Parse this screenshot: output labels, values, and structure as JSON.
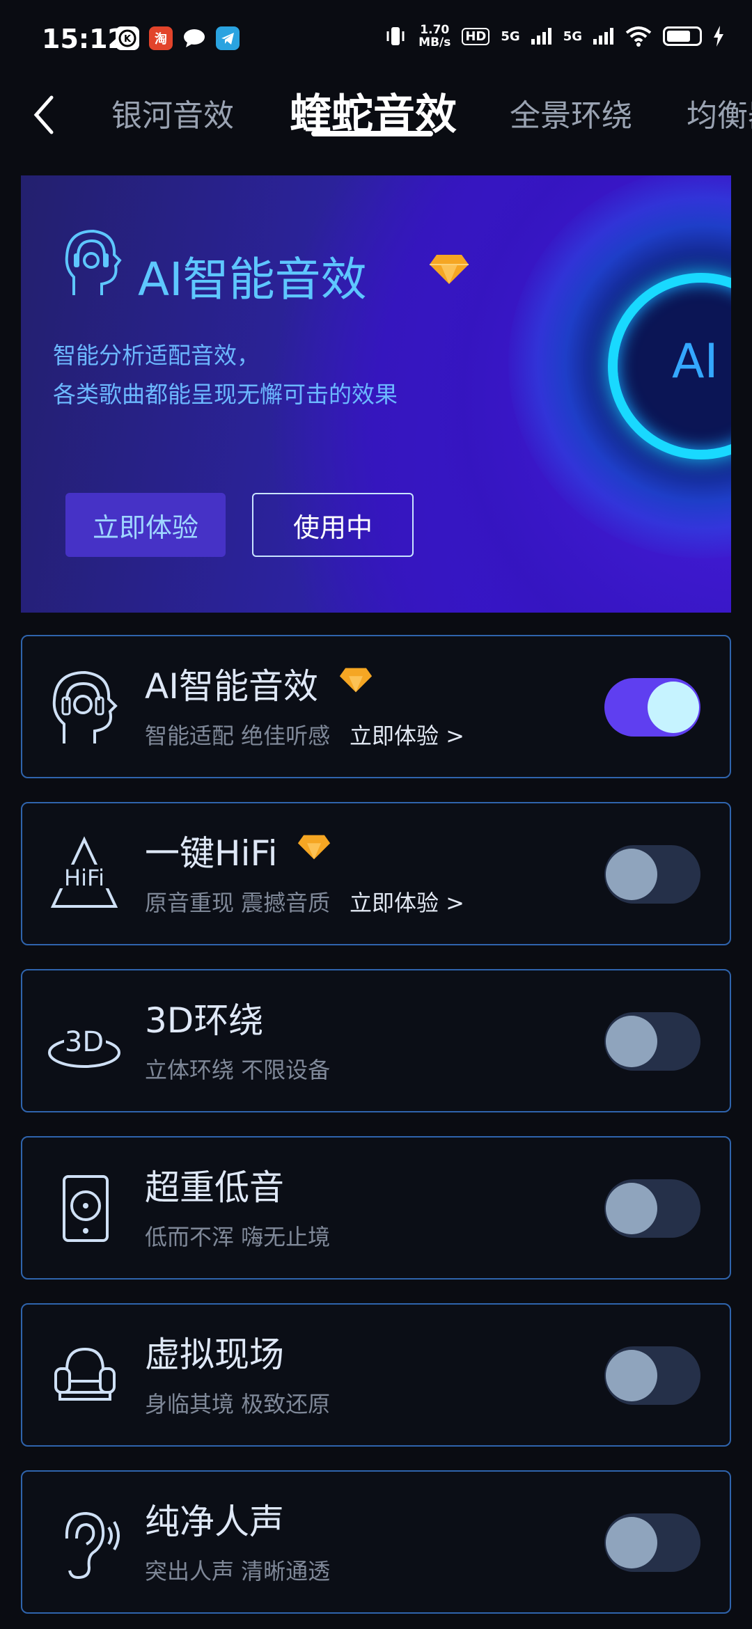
{
  "status_bar": {
    "time": "15:12",
    "app_icons": [
      "app-k-icon",
      "taobao-icon",
      "message-bubble-icon",
      "telegram-icon"
    ],
    "net_speed_value": "1.70",
    "net_speed_unit": "MB/s",
    "hd_label": "HD",
    "sim1_label": "5G",
    "sim2_label": "5G"
  },
  "tabs": {
    "back_icon": "chevron-left-icon",
    "items": [
      "银河音效",
      "蝰蛇音效",
      "全景环绕",
      "均衡器"
    ],
    "active_index": 1
  },
  "banner": {
    "title": "AI智能音效",
    "subtitle_line1": "智能分析适配音效，",
    "subtitle_line2": "各类歌曲都能呈现无懈可击的效果",
    "try_button": "立即体验",
    "using_button": "使用中",
    "orb_text": "AI",
    "accent_color": "#5ec7ff"
  },
  "effects": [
    {
      "title": "AI智能音效",
      "subtitle": "智能适配 绝佳听感",
      "link": "立即体验 >",
      "premium": true,
      "enabled": true,
      "icon": "ai-head-icon"
    },
    {
      "title": "一键HiFi",
      "subtitle": "原音重现 震撼音质",
      "link": "立即体验 >",
      "premium": true,
      "enabled": false,
      "icon": "hifi-icon",
      "icon_text": "HiFi"
    },
    {
      "title": "3D环绕",
      "subtitle": "立体环绕 不限设备",
      "premium": false,
      "enabled": false,
      "icon": "3d-surround-icon",
      "icon_text": "3D"
    },
    {
      "title": "超重低音",
      "subtitle": "低而不浑 嗨无止境",
      "premium": false,
      "enabled": false,
      "icon": "speaker-icon"
    },
    {
      "title": "虚拟现场",
      "subtitle": "身临其境 极致还原",
      "premium": false,
      "enabled": false,
      "icon": "armchair-icon"
    },
    {
      "title": "纯净人声",
      "subtitle": "突出人声 清晰通透",
      "premium": false,
      "enabled": false,
      "icon": "ear-icon"
    }
  ],
  "colors": {
    "background": "#0a0c12",
    "card_border": "#2f64ad",
    "toggle_on": "#5f3ff0",
    "toggle_off": "#253049",
    "diamond": "#f5a623"
  }
}
